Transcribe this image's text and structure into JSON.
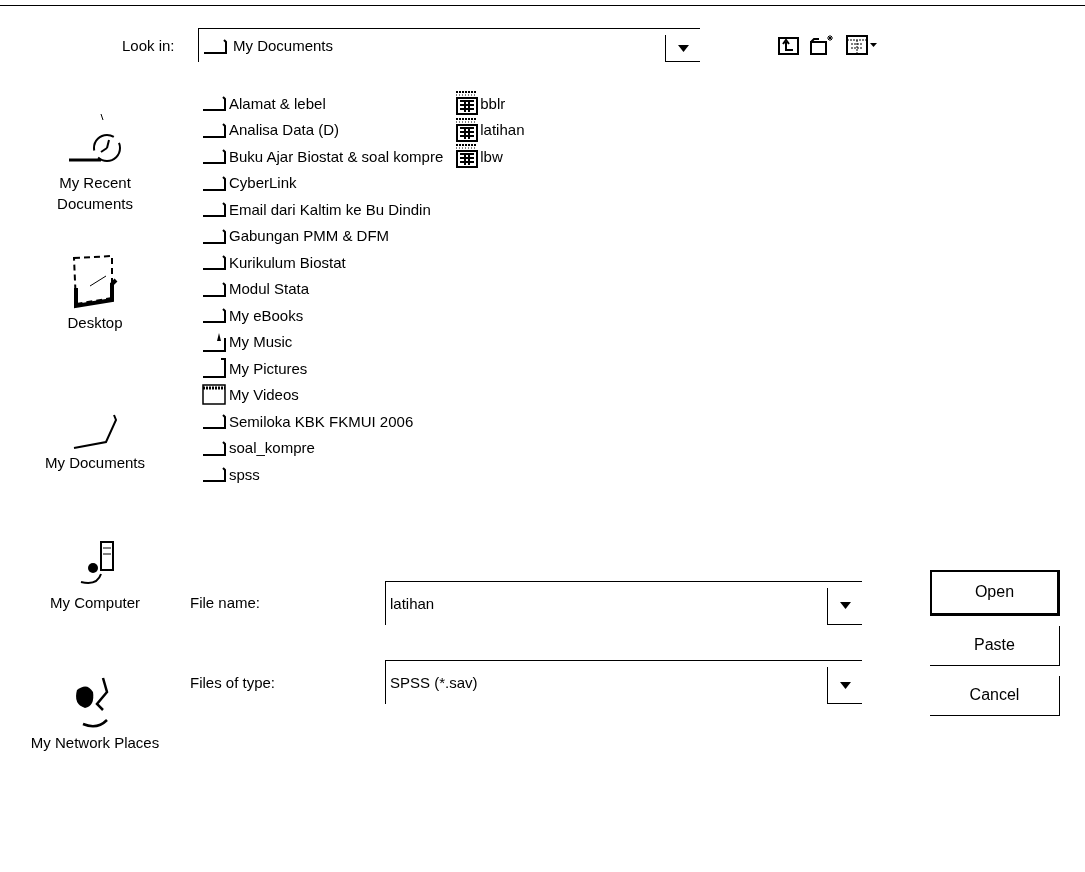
{
  "look_in": {
    "label": "Look in:",
    "value": "My Documents"
  },
  "places": [
    {
      "kind": "recent",
      "label": "My Recent Documents"
    },
    {
      "kind": "desktop",
      "label": "Desktop"
    },
    {
      "kind": "documents",
      "label": "My Documents"
    },
    {
      "kind": "computer",
      "label": "My Computer"
    },
    {
      "kind": "network",
      "label": "My Network Places"
    }
  ],
  "files": [
    {
      "kind": "folder",
      "name": "Alamat & lebel"
    },
    {
      "kind": "folder",
      "name": "Analisa Data (D)"
    },
    {
      "kind": "folder",
      "name": "Buku Ajar Biostat & soal kompre"
    },
    {
      "kind": "folder",
      "name": "CyberLink"
    },
    {
      "kind": "folder",
      "name": "Email dari Kaltim ke Bu Dindin"
    },
    {
      "kind": "folder",
      "name": "Gabungan PMM & DFM"
    },
    {
      "kind": "folder",
      "name": "Kurikulum Biostat"
    },
    {
      "kind": "folder",
      "name": "Modul Stata"
    },
    {
      "kind": "folder",
      "name": "My eBooks"
    },
    {
      "kind": "music",
      "name": "My Music"
    },
    {
      "kind": "pictures",
      "name": "My Pictures"
    },
    {
      "kind": "videos",
      "name": "My Videos"
    },
    {
      "kind": "folder",
      "name": "Semiloka KBK FKMUI 2006"
    },
    {
      "kind": "folder",
      "name": "soal_kompre"
    },
    {
      "kind": "folder",
      "name": "spss"
    },
    {
      "kind": "spss",
      "name": "bblr"
    },
    {
      "kind": "spss",
      "name": "latihan"
    },
    {
      "kind": "spss",
      "name": "lbw"
    }
  ],
  "file_name": {
    "label": "File name:",
    "value": "latihan"
  },
  "file_type": {
    "label": "Files of type:",
    "value": "SPSS (*.sav)"
  },
  "buttons": [
    {
      "label": "Open",
      "default": true
    },
    {
      "label": "Paste",
      "default": false
    },
    {
      "label": "Cancel",
      "default": false
    }
  ]
}
